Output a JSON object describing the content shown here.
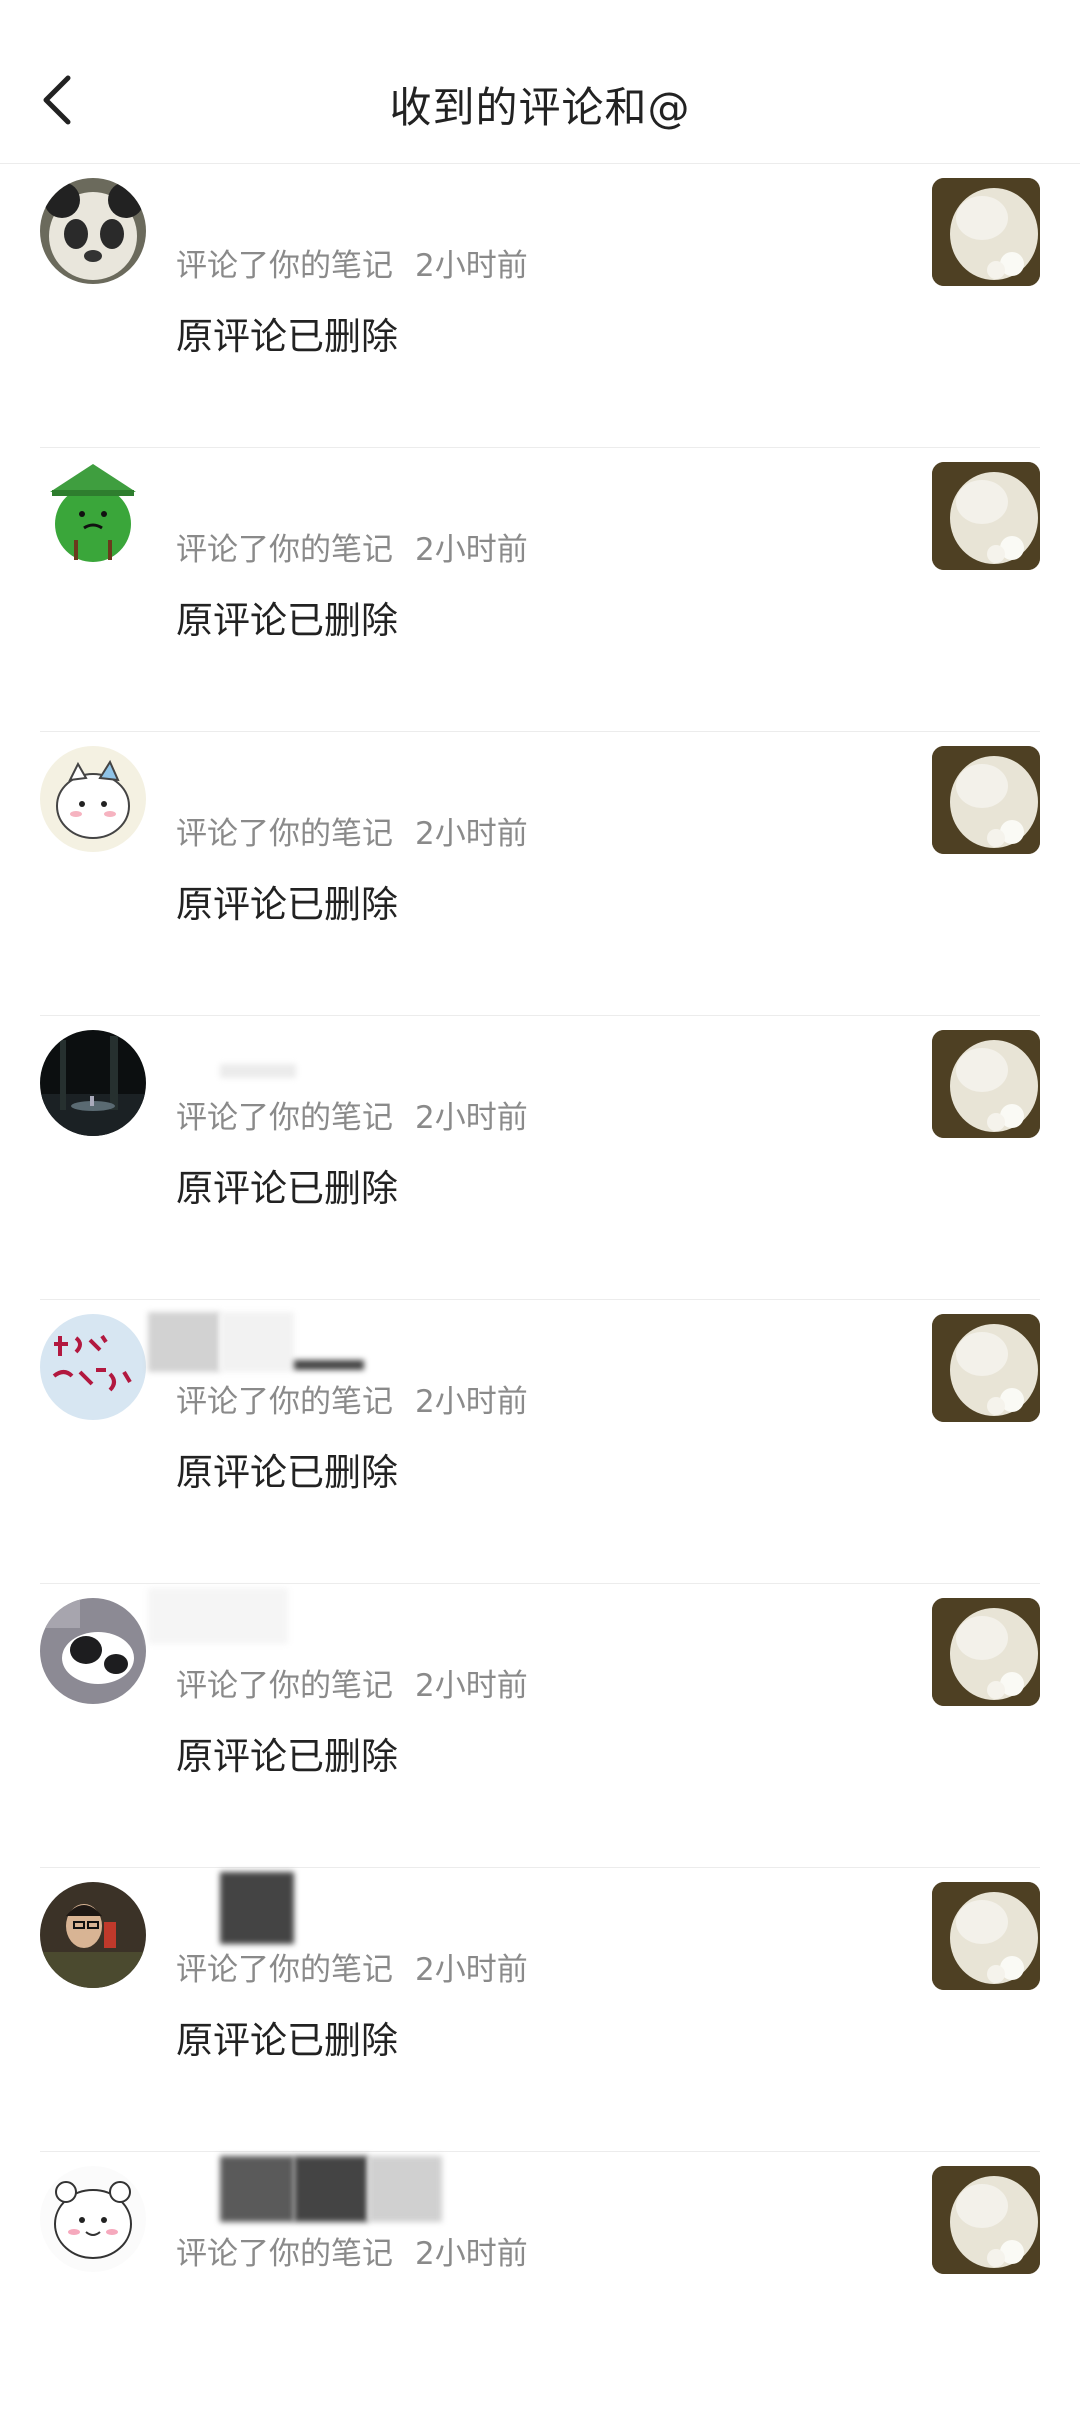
{
  "header": {
    "title": "收到的评论和@",
    "back_icon": "chevron-left-icon"
  },
  "notifications": [
    {
      "avatar": "panda-avatar",
      "action": "评论了你的笔记",
      "time": "2小时前",
      "content": "原评论已删除",
      "thumb": "note-thumbnail"
    },
    {
      "avatar": "green-character-avatar",
      "action": "评论了你的笔记",
      "time": "2小时前",
      "content": "原评论已删除",
      "thumb": "note-thumbnail"
    },
    {
      "avatar": "cartoon-cat-avatar",
      "action": "评论了你的笔记",
      "time": "2小时前",
      "content": "原评论已删除",
      "thumb": "note-thumbnail"
    },
    {
      "avatar": "night-forest-avatar",
      "action": "评论了你的笔记",
      "time": "2小时前",
      "content": "原评论已删除",
      "thumb": "note-thumbnail"
    },
    {
      "avatar": "handwriting-avatar",
      "action": "评论了你的笔记",
      "time": "2小时前",
      "content": "原评论已删除",
      "thumb": "note-thumbnail"
    },
    {
      "avatar": "cat-photo-avatar",
      "action": "评论了你的笔记",
      "time": "2小时前",
      "content": "原评论已删除",
      "thumb": "note-thumbnail"
    },
    {
      "avatar": "person-photo-avatar",
      "action": "评论了你的笔记",
      "time": "2小时前",
      "content": "原评论已删除",
      "thumb": "note-thumbnail"
    },
    {
      "avatar": "cartoon-bear-avatar",
      "action": "评论了你的笔记",
      "time": "2小时前",
      "content": "",
      "thumb": "note-thumbnail"
    }
  ]
}
